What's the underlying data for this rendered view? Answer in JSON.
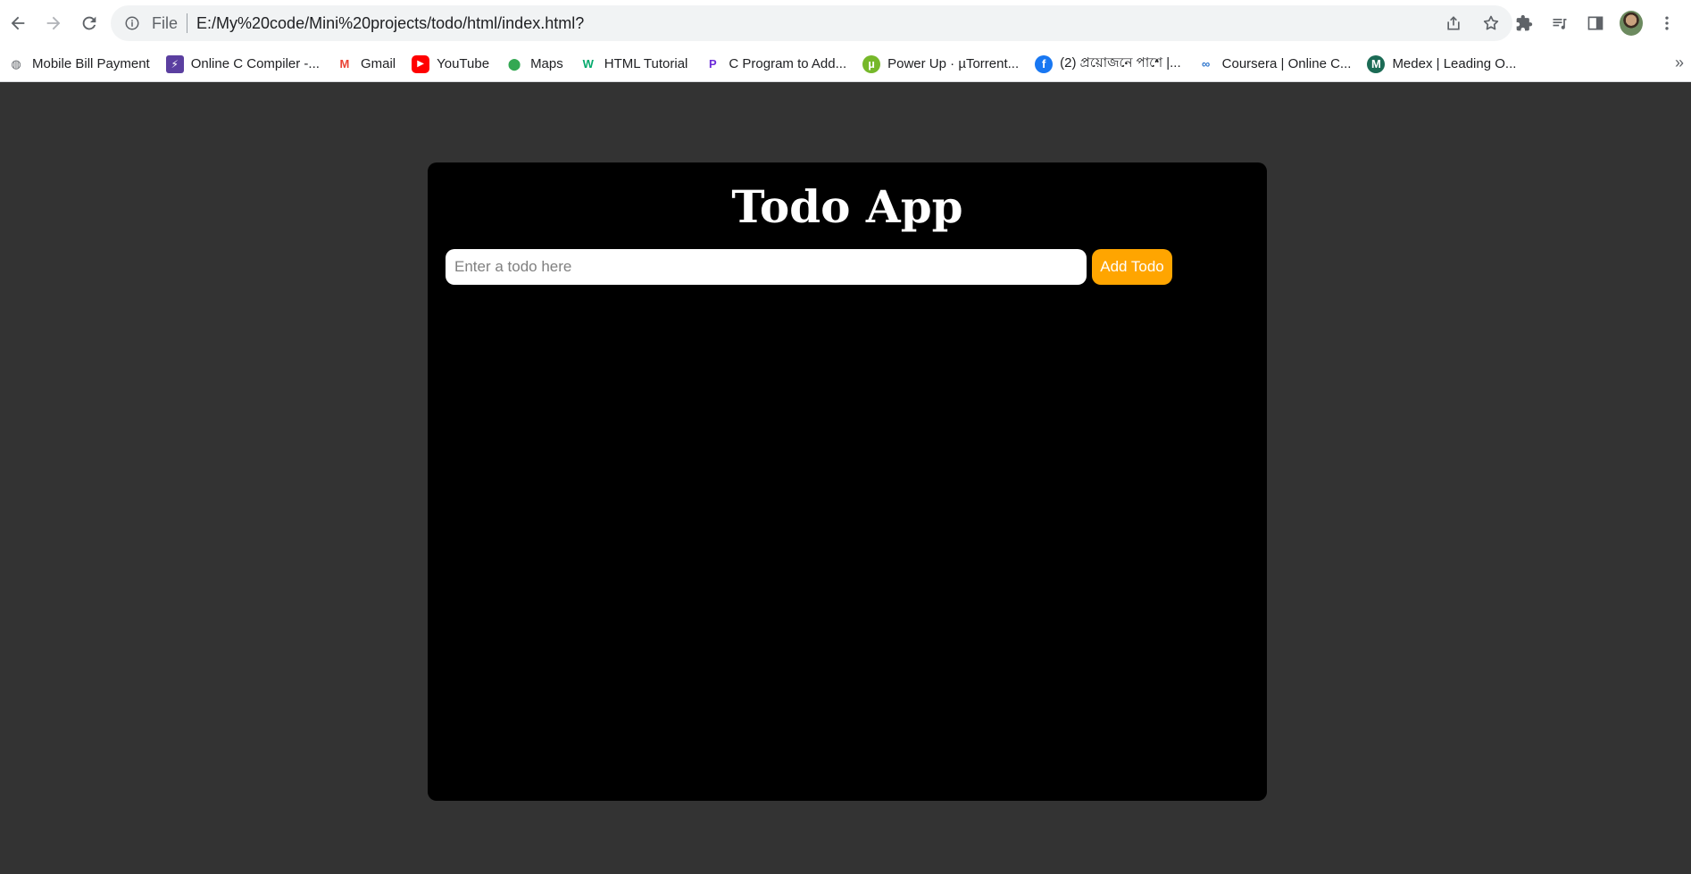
{
  "browser": {
    "scheme": "File",
    "url": "E:/My%20code/Mini%20projects/todo/html/index.html?"
  },
  "bookmarks": [
    {
      "label": "Mobile Bill Payment",
      "icon": "globe-icon",
      "color": "#5f6368"
    },
    {
      "label": "Online C Compiler -...",
      "icon": "bolt-icon",
      "color": "#5b3fa0"
    },
    {
      "label": "Gmail",
      "icon": "gmail-icon",
      "color": "#ea4335"
    },
    {
      "label": "YouTube",
      "icon": "youtube-icon",
      "color": "#ff0000"
    },
    {
      "label": "Maps",
      "icon": "maps-pin-icon",
      "color": "#34a853"
    },
    {
      "label": "HTML Tutorial",
      "icon": "w3schools-icon",
      "color": "#04aa6d"
    },
    {
      "label": "C Program to Add...",
      "icon": "programiz-icon",
      "color": "#6c2bd9"
    },
    {
      "label": "Power Up · µTorrent...",
      "icon": "utorrent-icon",
      "color": "#76b82a"
    },
    {
      "label": "(2) প্রয়োজনে পাশে |...",
      "icon": "facebook-icon",
      "color": "#1877f2"
    },
    {
      "label": "Coursera | Online C...",
      "icon": "coursera-icon",
      "color": "#2a73cc"
    },
    {
      "label": "Medex | Leading O...",
      "icon": "medex-icon",
      "color": "#1b6b55"
    }
  ],
  "app": {
    "title": "Todo App",
    "input_placeholder": "Enter a todo here",
    "input_value": "",
    "add_button_label": "Add Todo",
    "accent_color": "#ffa500"
  }
}
